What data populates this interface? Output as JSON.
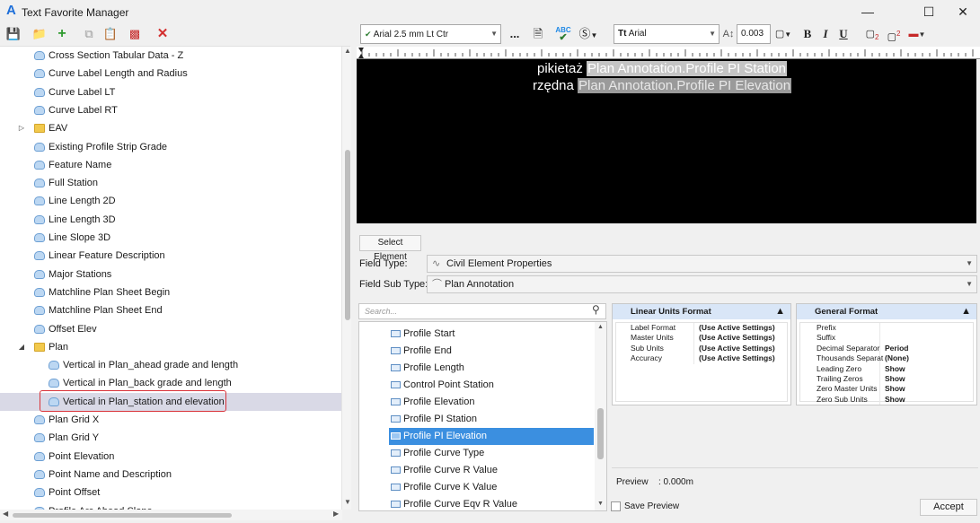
{
  "window": {
    "title": "Text Favorite Manager",
    "minimize_icon": "minimize-icon",
    "maximize_icon": "maximize-icon",
    "close_icon": "close-icon"
  },
  "left_toolbar": {
    "icons": [
      "save-icon",
      "new-folder-icon",
      "add-icon",
      "copy-icon",
      "paste-icon",
      "rename-icon",
      "delete-icon"
    ]
  },
  "tree": {
    "items": [
      {
        "label": "Cross Section Tabular Data - Z",
        "type": "item",
        "level": 1
      },
      {
        "label": "Curve Label Length and Radius",
        "type": "item",
        "level": 1
      },
      {
        "label": "Curve Label LT",
        "type": "item",
        "level": 1
      },
      {
        "label": "Curve Label RT",
        "type": "item",
        "level": 1
      },
      {
        "label": "EAV",
        "type": "folder",
        "level": 1,
        "expander": "collapsed"
      },
      {
        "label": "Existing Profile Strip Grade",
        "type": "item",
        "level": 1
      },
      {
        "label": "Feature Name",
        "type": "item",
        "level": 1
      },
      {
        "label": "Full Station",
        "type": "item",
        "level": 1
      },
      {
        "label": "Line Length 2D",
        "type": "item",
        "level": 1
      },
      {
        "label": "Line Length 3D",
        "type": "item",
        "level": 1
      },
      {
        "label": "Line Slope 3D",
        "type": "item",
        "level": 1
      },
      {
        "label": "Linear Feature Description",
        "type": "item",
        "level": 1
      },
      {
        "label": "Major Stations",
        "type": "item",
        "level": 1
      },
      {
        "label": "Matchline Plan Sheet Begin",
        "type": "item",
        "level": 1
      },
      {
        "label": "Matchline Plan Sheet End",
        "type": "item",
        "level": 1
      },
      {
        "label": "Offset Elev",
        "type": "item",
        "level": 1
      },
      {
        "label": "Plan",
        "type": "folder",
        "level": 1,
        "expander": "expanded"
      },
      {
        "label": "Vertical in Plan_ahead grade and length",
        "type": "item",
        "level": 2
      },
      {
        "label": "Vertical in Plan_back grade and length",
        "type": "item",
        "level": 2
      },
      {
        "label": "Vertical in Plan_station and elevation",
        "type": "item",
        "level": 2,
        "selected": true
      },
      {
        "label": "Plan Grid X",
        "type": "item",
        "level": 1
      },
      {
        "label": "Plan Grid Y",
        "type": "item",
        "level": 1
      },
      {
        "label": "Point Elevation",
        "type": "item",
        "level": 1
      },
      {
        "label": "Point Name and Description",
        "type": "item",
        "level": 1
      },
      {
        "label": "Point Offset",
        "type": "item",
        "level": 1
      },
      {
        "label": "Profile Arc Ahead Slope",
        "type": "item",
        "level": 1
      }
    ]
  },
  "format_toolbar": {
    "text_style": "Arial 2.5 mm Lt Ctr",
    "more_label": "...",
    "font": "Arial",
    "height_value": "0.003",
    "bold_label": "B",
    "italic_label": "I",
    "underline_label": "U",
    "spell_label": "ABC",
    "icons": [
      "text-style-icon",
      "fields-icon",
      "spell-check-icon",
      "symbol-icon",
      "font-icon",
      "height-icon",
      "color-icon",
      "subscript-icon",
      "superscript-icon",
      "highlight-icon"
    ]
  },
  "editor": {
    "line1_prefix": "pikietaż",
    "line1_field": "Plan Annotation.Profile PI Station",
    "line2_prefix": "rzędna",
    "line2_field": "Plan Annotation.Profile PI Elevation"
  },
  "select_element_label": "Select Element",
  "field_type": {
    "label": "Field Type:",
    "value": "Civil Element Properties"
  },
  "field_sub_type": {
    "label": "Field Sub Type:",
    "value": "Plan Annotation"
  },
  "search": {
    "placeholder": "Search..."
  },
  "properties": {
    "items": [
      {
        "label": "Profile Start"
      },
      {
        "label": "Profile End"
      },
      {
        "label": "Profile Length"
      },
      {
        "label": "Control Point Station"
      },
      {
        "label": "Profile Elevation"
      },
      {
        "label": "Profile PI Station"
      },
      {
        "label": "Profile PI Elevation",
        "selected": true
      },
      {
        "label": "Profile Curve Type"
      },
      {
        "label": "Profile Curve R Value"
      },
      {
        "label": "Profile Curve K Value"
      },
      {
        "label": "Profile Curve Eqv R Value"
      }
    ]
  },
  "linear_units": {
    "title": "Linear Units Format",
    "rows": [
      {
        "label": "Label Format",
        "value": "(Use Active Settings)"
      },
      {
        "label": "Master Units",
        "value": "(Use Active Settings)"
      },
      {
        "label": "Sub Units",
        "value": "(Use Active Settings)"
      },
      {
        "label": "Accuracy",
        "value": "(Use Active Settings)"
      }
    ]
  },
  "general_format": {
    "title": "General Format",
    "rows": [
      {
        "label": "Prefix",
        "value": ""
      },
      {
        "label": "Suffix",
        "value": ""
      },
      {
        "label": "Decimal Separator",
        "value": "Period"
      },
      {
        "label": "Thousands Separat",
        "value": "(None)"
      },
      {
        "label": "Leading Zero",
        "value": "Show"
      },
      {
        "label": "Trailing Zeros",
        "value": "Show"
      },
      {
        "label": "Zero Master Units",
        "value": "Show"
      },
      {
        "label": "Zero Sub Units",
        "value": "Show"
      }
    ]
  },
  "preview": {
    "label": "Preview",
    "value": ": 0.000m"
  },
  "save_preview_label": "Save Preview",
  "accept_label": "Accept"
}
